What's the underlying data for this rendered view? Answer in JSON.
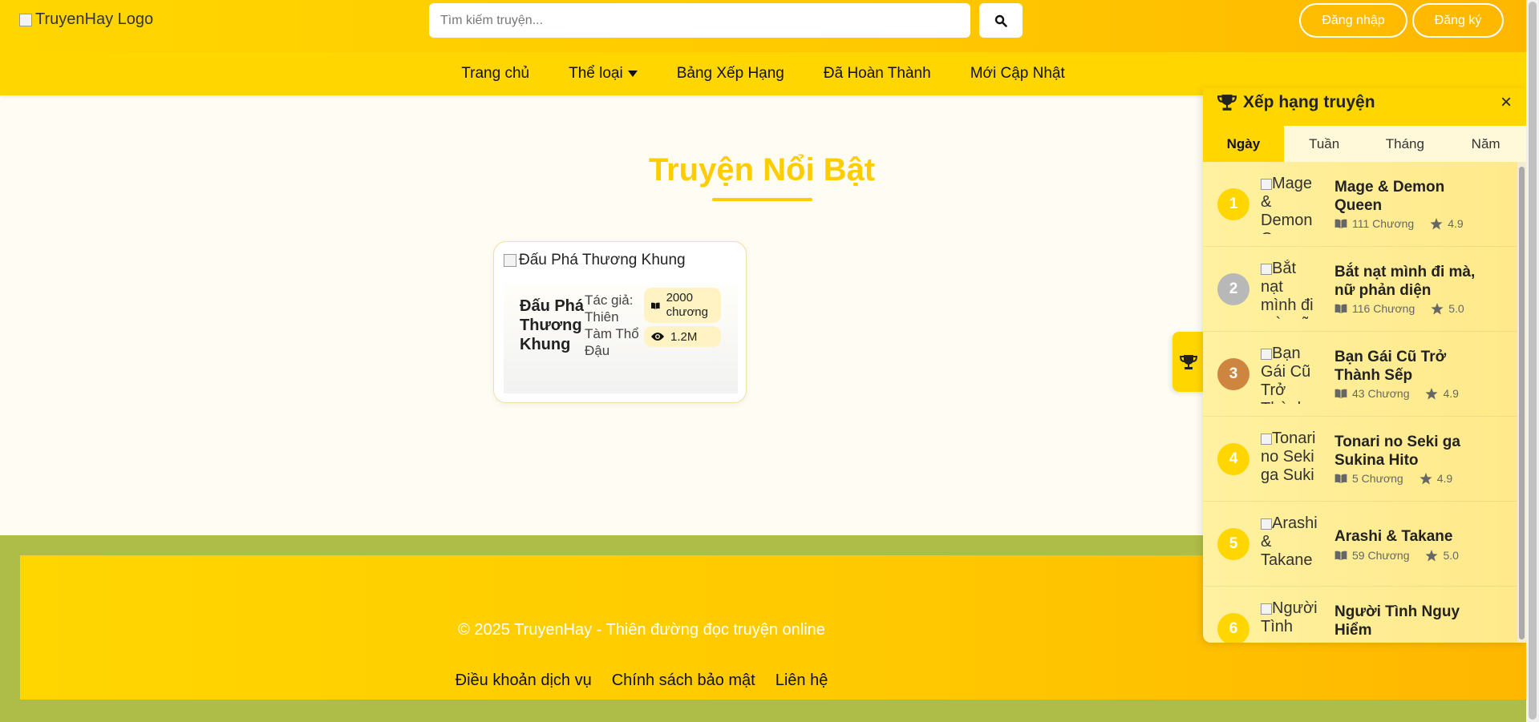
{
  "header": {
    "logo_alt": "TruyenHay Logo",
    "search_placeholder": "Tìm kiếm truyện...",
    "login_label": "Đăng nhập",
    "register_label": "Đăng ký"
  },
  "nav": {
    "items": [
      "Trang chủ",
      "Thể loại",
      "Bảng Xếp Hạng",
      "Đã Hoàn Thành",
      "Mới Cập Nhật"
    ]
  },
  "featured": {
    "title": "Truyện Nổi Bật",
    "card": {
      "image_alt": "Đấu Phá Thương Khung",
      "title": "Đấu Phá Thương Khung",
      "author": "Tác giả: Thiên Tàm Thổ Đậu",
      "chapters": "2000 chương",
      "views": "1.2M"
    }
  },
  "footer": {
    "copyright": "© 2025 TruyenHay - Thiên đường đọc truyện online",
    "links": [
      "Điều khoản dịch vụ",
      "Chính sách bảo mật",
      "Liên hệ"
    ]
  },
  "ranking": {
    "title": "Xếp hạng truyện",
    "close": "×",
    "tabs": [
      "Ngày",
      "Tuần",
      "Tháng",
      "Năm"
    ],
    "active_tab": "Ngày",
    "items": [
      {
        "rank": "1",
        "image_alt": "Mage & Demon Q",
        "title": "Mage & Demon Queen",
        "chapters": "111 Chương",
        "rating": "4.9"
      },
      {
        "rank": "2",
        "image_alt": "Bắt nạt mình đi mà, nữ",
        "title": "Bắt nạt mình đi mà, nữ phản diện",
        "chapters": "116 Chương",
        "rating": "5.0"
      },
      {
        "rank": "3",
        "image_alt": "Bạn Gái Cũ Trở Thành",
        "title": "Bạn Gái Cũ Trở Thành Sếp",
        "chapters": "43 Chương",
        "rating": "4.9"
      },
      {
        "rank": "4",
        "image_alt": "Tonari no Seki ga Suki",
        "title": "Tonari no Seki ga Sukina Hito",
        "chapters": "5 Chương",
        "rating": "4.9"
      },
      {
        "rank": "5",
        "image_alt": "Arashi & Takane",
        "title": "Arashi & Takane",
        "chapters": "59 Chương",
        "rating": "5.0"
      },
      {
        "rank": "6",
        "image_alt": "Người Tình",
        "title": "Người Tình Nguy Hiểm",
        "chapters": "",
        "rating": ""
      }
    ]
  },
  "colors": {
    "brand_yellow": "#ffd600",
    "title_yellow": "#ffcc00",
    "footer_olive": "#aebd47",
    "rank_gold": "#ffd600",
    "rank_silver": "#b8b8b8",
    "rank_bronze": "#cd853f"
  }
}
